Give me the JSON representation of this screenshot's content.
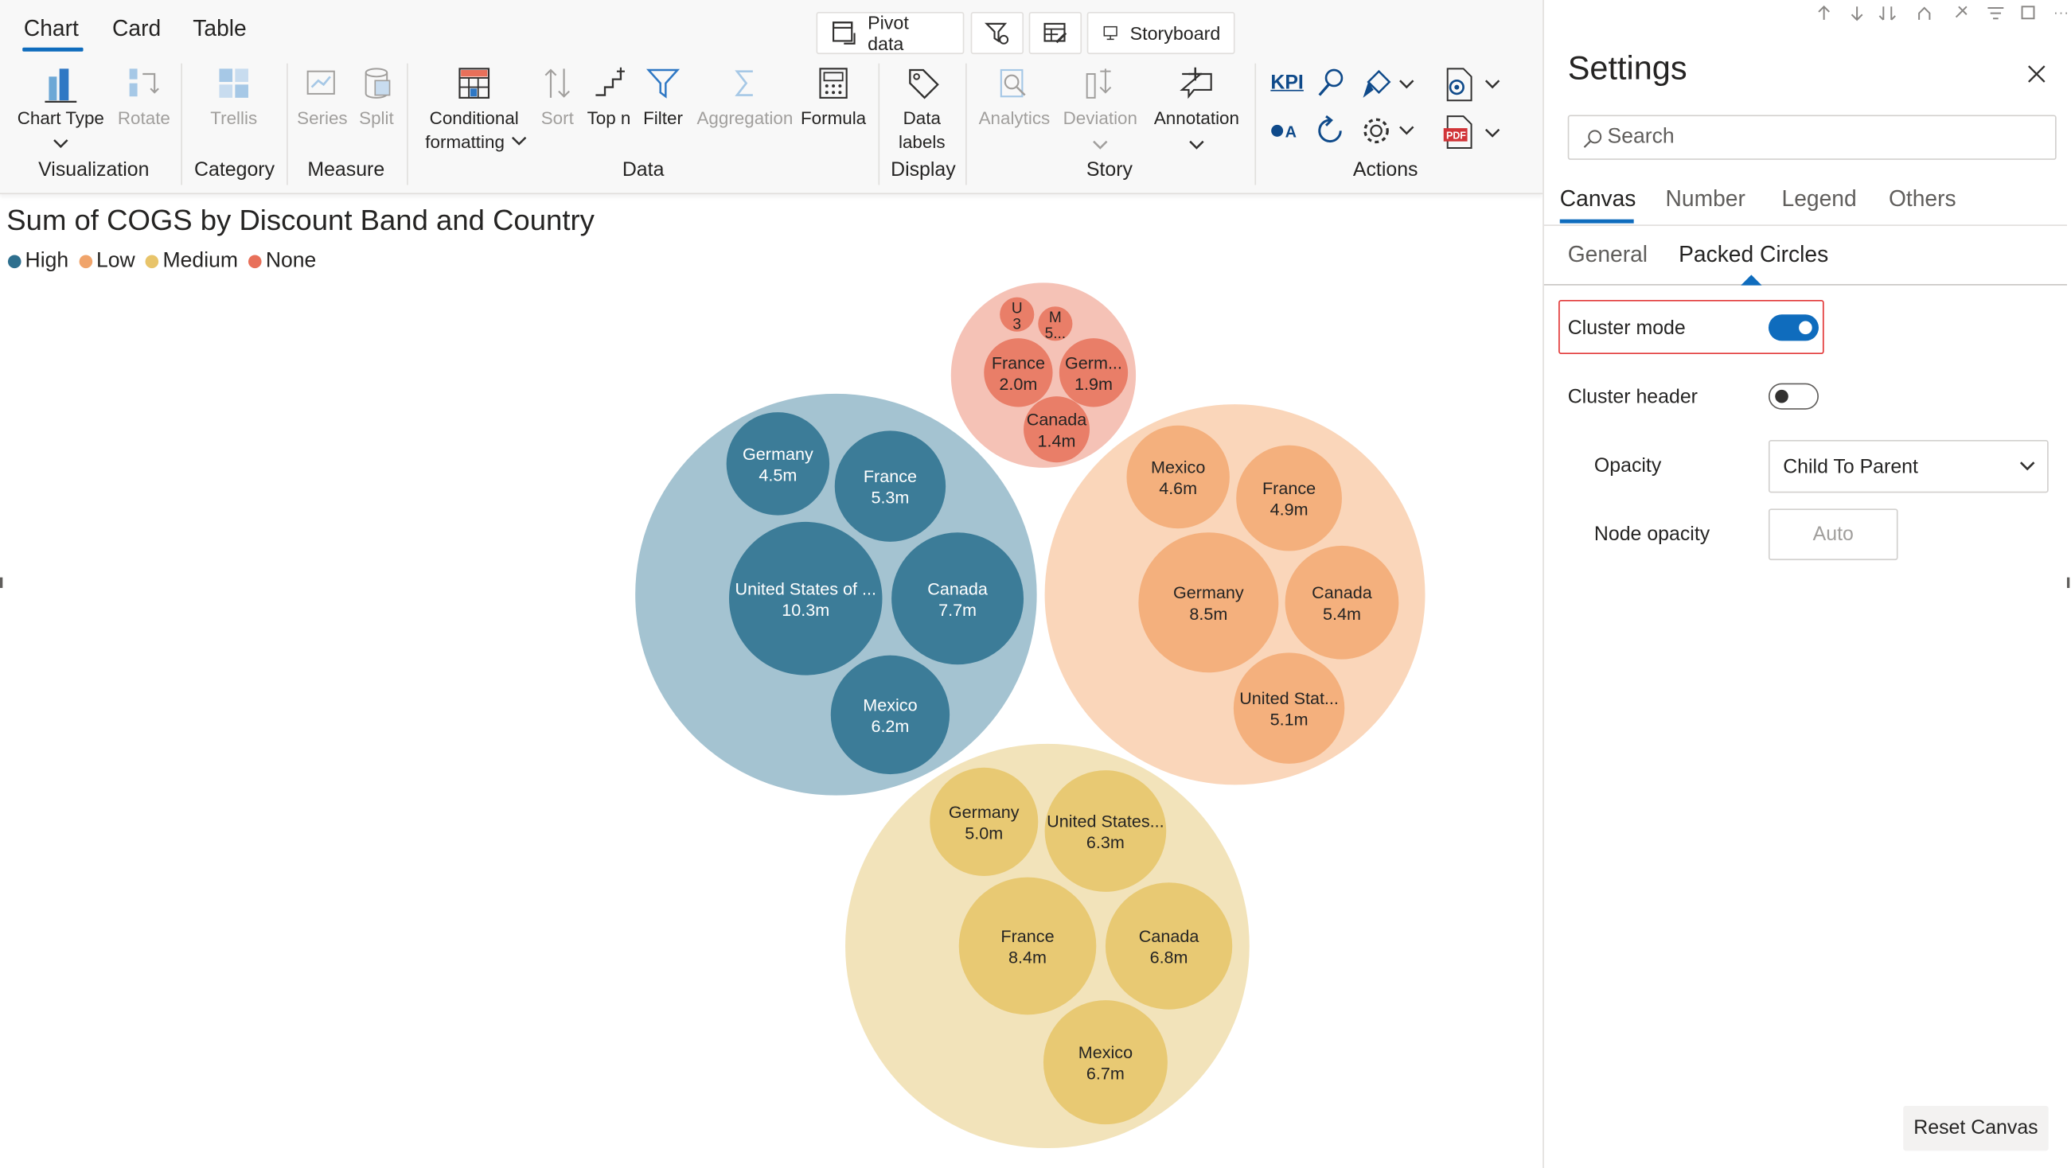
{
  "toolbar": {
    "tabs": [
      "Chart",
      "Card",
      "Table"
    ],
    "active_tab": "Chart",
    "top_buttons": {
      "pivot": "Pivot data",
      "storyboard": "Storyboard"
    },
    "items": {
      "chart_type": "Chart Type",
      "rotate": "Rotate",
      "trellis": "Trellis",
      "series": "Series",
      "split": "Split",
      "conditional_1": "Conditional",
      "conditional_2": "formatting",
      "sort": "Sort",
      "top_n": "Top n",
      "filter": "Filter",
      "aggregation": "Aggregation",
      "formula": "Formula",
      "data_labels_1": "Data",
      "data_labels_2": "labels",
      "analytics": "Analytics",
      "deviation": "Deviation",
      "annotation": "Annotation",
      "kpi": "KPI"
    },
    "groups": {
      "visualization": "Visualization",
      "category": "Category",
      "measure": "Measure",
      "data": "Data",
      "display": "Display",
      "story": "Story",
      "actions": "Actions"
    }
  },
  "chart": {
    "title": "Sum of COGS by Discount Band and Country",
    "legend": [
      {
        "label": "High",
        "color": "#2e6f8e"
      },
      {
        "label": "Low",
        "color": "#f0a46b"
      },
      {
        "label": "Medium",
        "color": "#e8c46a"
      },
      {
        "label": "None",
        "color": "#e8705a"
      }
    ]
  },
  "chart_data": {
    "type": "packed-circles",
    "title": "Sum of COGS by Discount Band and Country",
    "clusters": [
      {
        "name": "High",
        "nodes": [
          {
            "label": "Germany",
            "value_label": "4.5m",
            "value": 4.5
          },
          {
            "label": "France",
            "value_label": "5.3m",
            "value": 5.3
          },
          {
            "label": "United States of ...",
            "value_label": "10.3m",
            "value": 10.3
          },
          {
            "label": "Canada",
            "value_label": "7.7m",
            "value": 7.7
          },
          {
            "label": "Mexico",
            "value_label": "6.2m",
            "value": 6.2
          }
        ]
      },
      {
        "name": "Low",
        "nodes": [
          {
            "label": "Mexico",
            "value_label": "4.6m",
            "value": 4.6
          },
          {
            "label": "France",
            "value_label": "4.9m",
            "value": 4.9
          },
          {
            "label": "Germany",
            "value_label": "8.5m",
            "value": 8.5
          },
          {
            "label": "Canada",
            "value_label": "5.4m",
            "value": 5.4
          },
          {
            "label": "United Stat...",
            "value_label": "5.1m",
            "value": 5.1
          }
        ]
      },
      {
        "name": "Medium",
        "nodes": [
          {
            "label": "Germany",
            "value_label": "5.0m",
            "value": 5.0
          },
          {
            "label": "United States...",
            "value_label": "6.3m",
            "value": 6.3
          },
          {
            "label": "France",
            "value_label": "8.4m",
            "value": 8.4
          },
          {
            "label": "Canada",
            "value_label": "6.8m",
            "value": 6.8
          },
          {
            "label": "Mexico",
            "value_label": "6.7m",
            "value": 6.7
          }
        ]
      },
      {
        "name": "None",
        "nodes": [
          {
            "label": "U",
            "value_label": "3",
            "value": null
          },
          {
            "label": "M",
            "value_label": "5...",
            "value": null
          },
          {
            "label": "France",
            "value_label": "2.0m",
            "value": 2.0
          },
          {
            "label": "Germ...",
            "value_label": "1.9m",
            "value": 1.9
          },
          {
            "label": "Canada",
            "value_label": "1.4m",
            "value": 1.4
          }
        ]
      }
    ]
  },
  "settings": {
    "title": "Settings",
    "search_placeholder": "Search",
    "tabs": [
      "Canvas",
      "Number",
      "Legend",
      "Others"
    ],
    "active_tab": "Canvas",
    "subtabs": [
      "General",
      "Packed Circles"
    ],
    "active_subtab": "Packed Circles",
    "cluster_mode_label": "Cluster mode",
    "cluster_mode_on": true,
    "cluster_header_label": "Cluster header",
    "cluster_header_on": false,
    "opacity_label": "Opacity",
    "opacity_value": "Child To Parent",
    "node_opacity_label": "Node opacity",
    "node_opacity_placeholder": "Auto",
    "reset_button": "Reset Canvas"
  }
}
